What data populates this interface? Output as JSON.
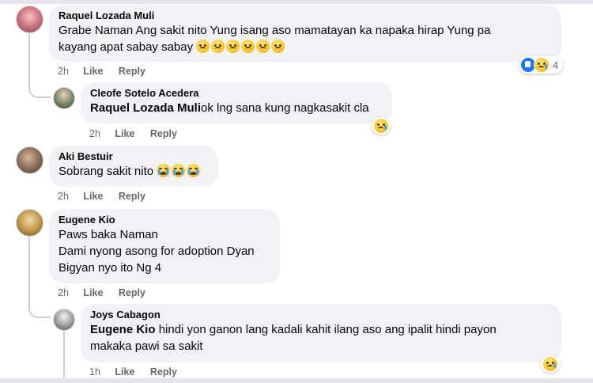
{
  "comments": [
    {
      "author": "Raquel Lozada Muli",
      "lines": [
        "Grabe Naman Ang sakit nito Yung isang aso mamatayan ka napaka hirap Yung pa",
        "kayang apat sabay sabay"
      ],
      "emoji_count": 6,
      "emoji": "sad-face-icon",
      "time": "2h",
      "like": "Like",
      "reply": "Reply",
      "reaction_count": "4",
      "replies": [
        {
          "author": "Cleofe Sotelo Acedera",
          "mention": "Raquel Lozada Muli",
          "text": "ok lng sana kung nagkasakit cla",
          "time": "2h",
          "like": "Like",
          "reply": "Reply"
        }
      ]
    },
    {
      "author": "Aki Bestuir",
      "lines": [
        "Sobrang sakit nito"
      ],
      "emoji_count": 3,
      "emoji": "crying-face-icon",
      "time": "2h",
      "like": "Like",
      "reply": "Reply"
    },
    {
      "author": "Eugene Kio",
      "lines": [
        "Paws baka Naman",
        "Dami nyong asong for adoption Dyan",
        "Bigyan nyo ito Ng 4"
      ],
      "time": "2h",
      "like": "Like",
      "reply": "Reply",
      "replies": [
        {
          "author": "Joys Cabagon",
          "mention": "Eugene Kio",
          "text": "hindi yon ganon lang kadali kahit ilang aso ang ipalit hindi payon",
          "text2": "makaka pawi sa sakit",
          "time": "1h",
          "like": "Like",
          "reply": "Reply"
        }
      ]
    }
  ],
  "colors": {
    "bubble": "#f0f2f5",
    "meta": "#65676b",
    "like_blue": "#1877f2"
  }
}
